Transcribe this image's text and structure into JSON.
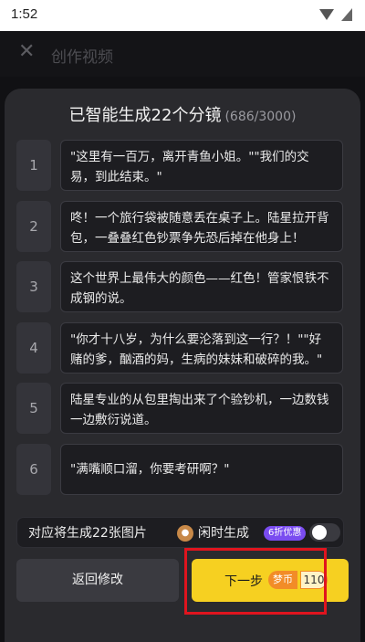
{
  "status": {
    "time": "1:52"
  },
  "header": {
    "title": "创作视频"
  },
  "sheet": {
    "title": "已智能生成22个分镜",
    "count": "(686/3000)",
    "shots": [
      {
        "num": "1",
        "text": "\"这里有一百万，离开青鱼小姐。\"\"我们的交易，到此结束。\""
      },
      {
        "num": "2",
        "text": "咚！一个旅行袋被随意丢在桌子上。陆星拉开背包，一叠叠红色钞票争先恐后掉在他身上！"
      },
      {
        "num": "3",
        "text": "这个世界上最伟大的颜色——红色！管家恨铁不成钢的说。"
      },
      {
        "num": "4",
        "text": "\"你才十八岁，为什么要沦落到这一行？！\"\"好赌的爹，酗酒的妈，生病的妹妹和破碎的我。\""
      },
      {
        "num": "5",
        "text": "陆星专业的从包里掏出来了个验钞机，一边数钱一边敷衍说道。"
      },
      {
        "num": "6",
        "text": "\"满嘴顺口溜，你要考研啊？\""
      }
    ],
    "images_label": "对应将生成22张图片",
    "idle_label": "闲时生成",
    "discount_badge": "6折优惠",
    "idle_toggle_on": false,
    "back_label": "返回修改",
    "next_label": "下一步",
    "coin_label": "梦币",
    "coin_value": "110"
  }
}
